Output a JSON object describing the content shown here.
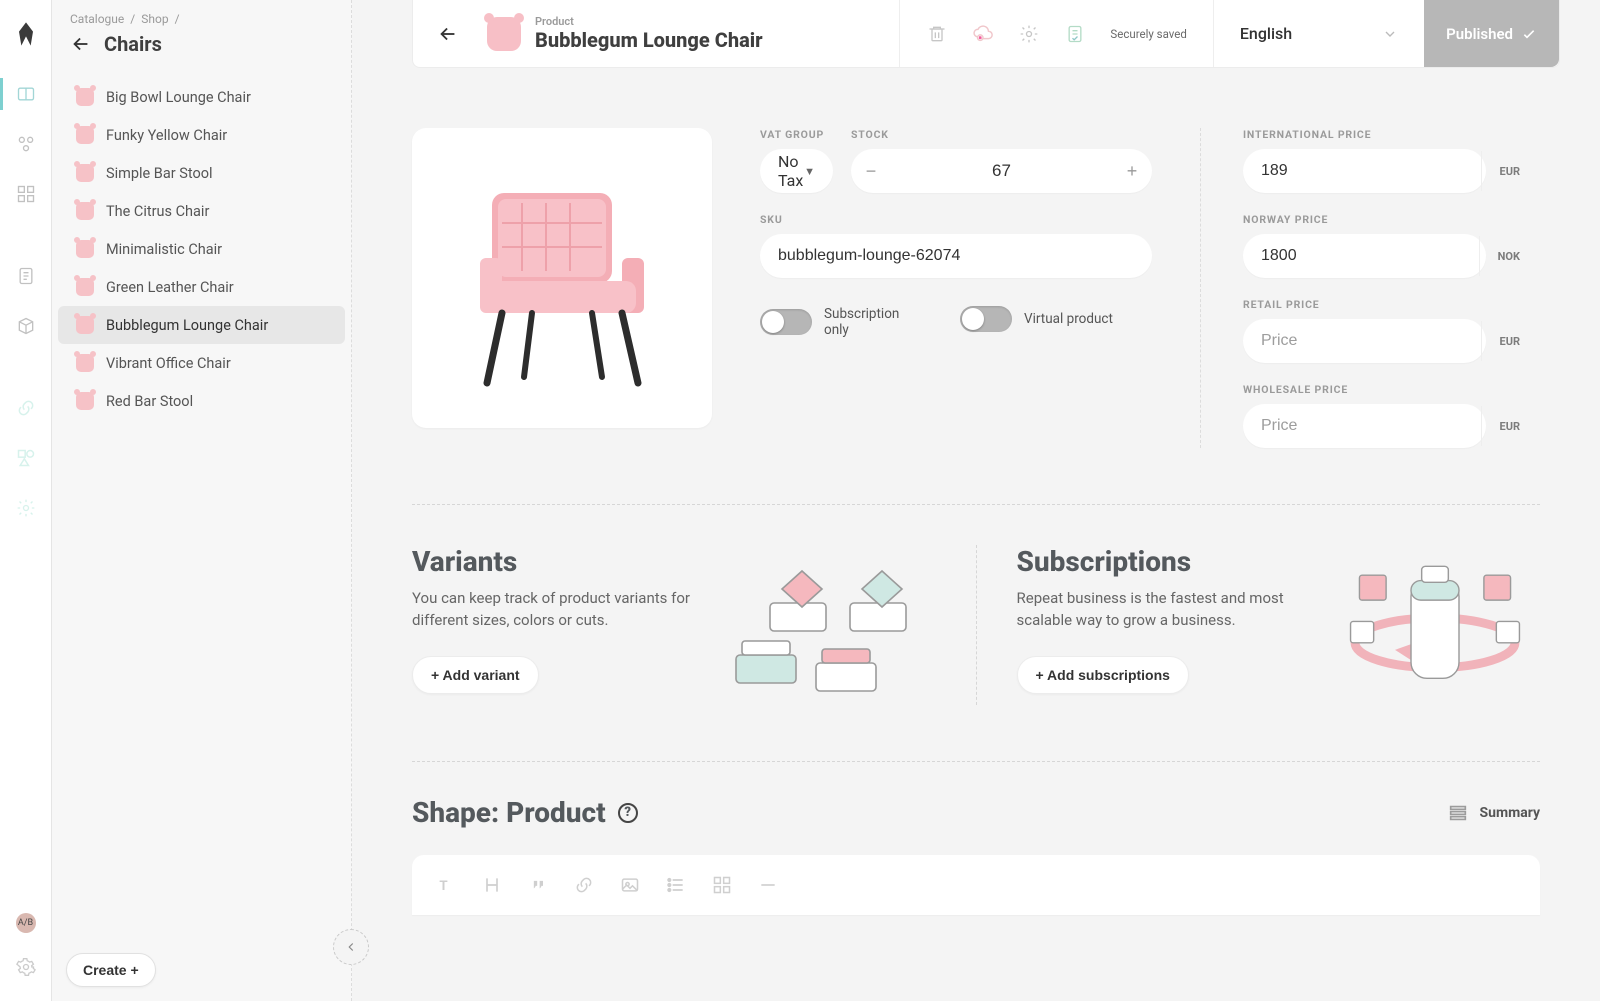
{
  "rail": {
    "label_badge": "A/B"
  },
  "sidebar": {
    "breadcrumbs": [
      "Catalogue",
      "Shop"
    ],
    "title": "Chairs",
    "items": [
      {
        "label": "Big Bowl Lounge Chair"
      },
      {
        "label": "Funky Yellow Chair"
      },
      {
        "label": "Simple Bar Stool"
      },
      {
        "label": "The Citrus Chair"
      },
      {
        "label": "Minimalistic Chair"
      },
      {
        "label": "Green Leather Chair"
      },
      {
        "label": "Bubblegum Lounge Chair",
        "selected": true
      },
      {
        "label": "Vibrant Office Chair"
      },
      {
        "label": "Red Bar Stool"
      }
    ],
    "create_label": "Create +"
  },
  "header": {
    "kind": "Product",
    "title": "Bubblegum Lounge Chair",
    "saved_text": "Securely saved",
    "language": "English",
    "publish_label": "Published"
  },
  "fields": {
    "vat_group_label": "VAT GROUP",
    "vat_value": "No Tax",
    "stock_label": "STOCK",
    "stock_value": "67",
    "sku_label": "SKU",
    "sku_value": "bubblegum-lounge-62074",
    "toggle_sub": "Subscription only",
    "toggle_virtual": "Virtual product"
  },
  "prices": {
    "international_label": "INTERNATIONAL PRICE",
    "international_value": "189",
    "international_curr": "EUR",
    "norway_label": "NORWAY PRICE",
    "norway_value": "1800",
    "norway_curr": "NOK",
    "retail_label": "RETAIL PRICE",
    "retail_placeholder": "Price",
    "retail_curr": "EUR",
    "wholesale_label": "WHOLESALE PRICE",
    "wholesale_placeholder": "Price",
    "wholesale_curr": "EUR"
  },
  "variants": {
    "title": "Variants",
    "desc": "You can keep track of product variants for different sizes, colors or cuts.",
    "button": "+ Add variant"
  },
  "subs": {
    "title": "Subscriptions",
    "desc": "Repeat business is the fastest and most scalable way to grow a business.",
    "button": "+ Add subscriptions"
  },
  "shape": {
    "title": "Shape: Product",
    "summary": "Summary"
  }
}
